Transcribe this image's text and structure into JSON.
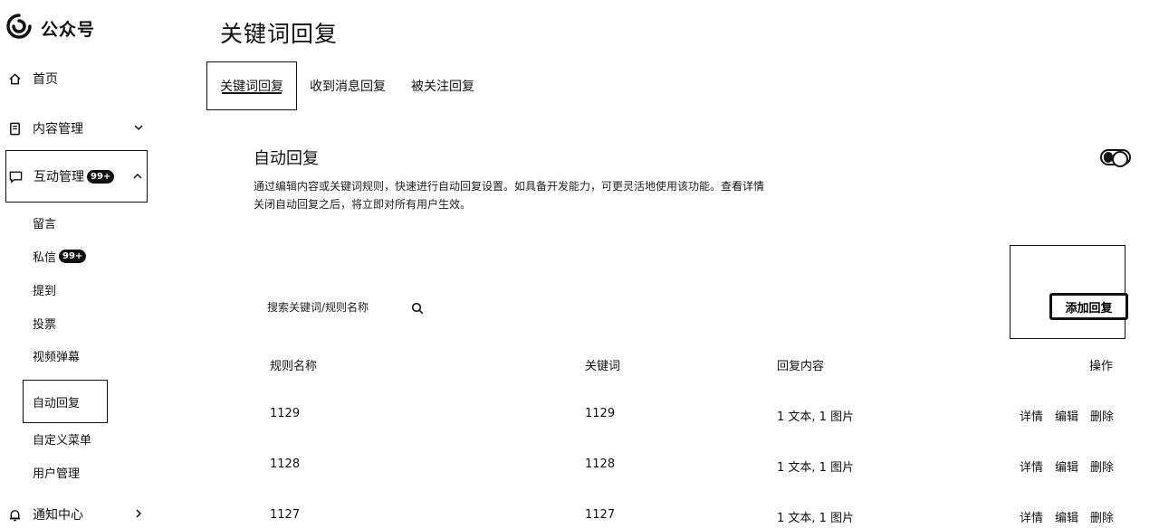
{
  "app": {
    "name": "公众号"
  },
  "sidebar": {
    "home": "首页",
    "content": "内容管理",
    "interaction": "互动管理",
    "interaction_badge": "99+",
    "sub_items": [
      "留言",
      "私信",
      "提到",
      "投票",
      "视频弹幕",
      "自动回复",
      "自定义菜单",
      "用户管理"
    ],
    "message_badge": "99+",
    "notice": "通知中心"
  },
  "page": {
    "title": "关键词回复"
  },
  "tabs": [
    "关键词回复",
    "收到消息回复",
    "被关注回复"
  ],
  "auto_reply": {
    "title": "自动回复",
    "desc_line1": "通过编辑内容或关键词规则，快速进行自动回复设置。如具备开发能力，可更灵活地使用该功能。",
    "desc_link": "查看详情",
    "desc_line2": "关闭自动回复之后，将立即对所有用户生效。",
    "enabled": true
  },
  "search": {
    "placeholder": "搜索关键词/规则名称"
  },
  "add_button": "添加回复",
  "table": {
    "headers": [
      "规则名称",
      "关键词",
      "回复内容",
      "操作"
    ],
    "rows": [
      {
        "name": "1129",
        "keyword": "1129",
        "content": "1 文本, 1 图片"
      },
      {
        "name": "1128",
        "keyword": "1128",
        "content": "1 文本, 1 图片"
      },
      {
        "name": "1127",
        "keyword": "1127",
        "content": "1 文本, 1 图片"
      }
    ],
    "actions": [
      "详情",
      "编辑",
      "删除"
    ]
  }
}
